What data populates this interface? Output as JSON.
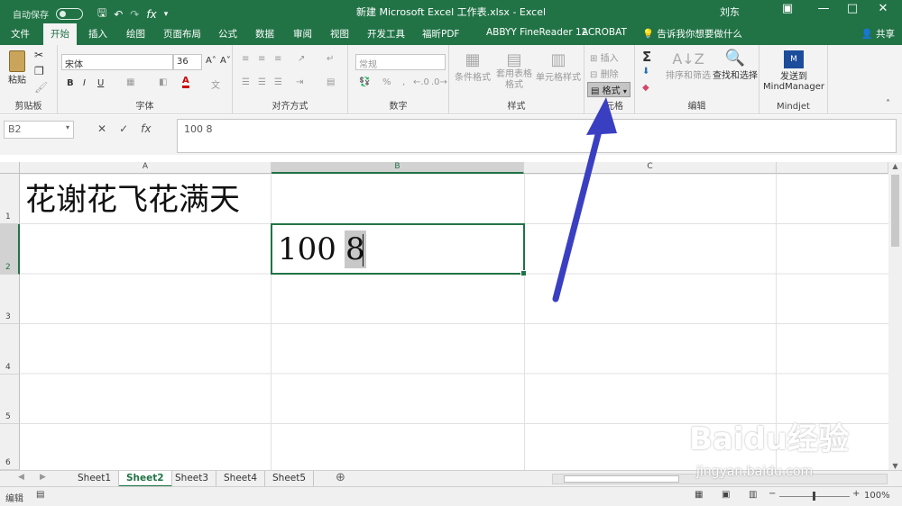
{
  "titlebar": {
    "autosave": "自动保存",
    "autosave_state": "关",
    "title": "新建 Microsoft Excel 工作表.xlsx  -  Excel",
    "user": "刘东"
  },
  "tabs": [
    "文件",
    "开始",
    "插入",
    "绘图",
    "页面布局",
    "公式",
    "数据",
    "审阅",
    "视图",
    "开发工具",
    "福昕PDF",
    "ABBYY FineReader 12",
    "ACROBAT"
  ],
  "tell_me": "告诉我你想要做什么",
  "share": "共享",
  "ribbon": {
    "clipboard": {
      "paste": "粘贴",
      "label": "剪贴板"
    },
    "font": {
      "name": "宋体",
      "size": "36",
      "bold": "B",
      "italic": "I",
      "underline": "U",
      "label": "字体"
    },
    "alignment": {
      "label": "对齐方式"
    },
    "number": {
      "format": "常规",
      "percent": "%",
      "label": "数字"
    },
    "styles": {
      "conditional": "条件格式",
      "table": "套用表格格式",
      "cell": "单元格样式",
      "label": "样式"
    },
    "cells": {
      "insert": "插入",
      "delete": "删除",
      "format": "格式",
      "label": "单元格",
      "label_visible": "元格"
    },
    "editing": {
      "sort": "排序和筛选",
      "find": "查找和选择",
      "label": "编辑"
    },
    "mindjet": {
      "send": "发送到",
      "app": "MindManager",
      "label": "Mindjet"
    }
  },
  "formula_bar": {
    "name_box": "B2",
    "formula": "100 8"
  },
  "columns": [
    "A",
    "B",
    "C"
  ],
  "rows": [
    "1",
    "2",
    "3",
    "4",
    "5",
    "6"
  ],
  "cells": {
    "A1": "花谢花飞花满天",
    "B2_left": "100",
    "B2_right": "8"
  },
  "sheets": [
    "Sheet1",
    "Sheet2",
    "Sheet3",
    "Sheet4",
    "Sheet5"
  ],
  "active_sheet": "Sheet2",
  "status": {
    "mode": "编辑",
    "zoom": "100%"
  },
  "watermark": {
    "logo": "Baidu经验",
    "url": "jingyan.baidu.com"
  },
  "colors": {
    "excel_green": "#217346",
    "arrow": "#3a3fc2"
  }
}
